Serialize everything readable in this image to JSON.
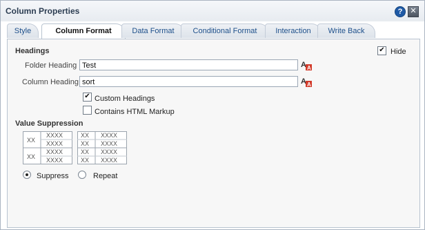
{
  "title": "Column Properties",
  "titlebar": {
    "help_glyph": "?",
    "close_glyph": "✕"
  },
  "tabs": [
    {
      "label": "Style",
      "active": false
    },
    {
      "label": "Column Format",
      "active": true
    },
    {
      "label": "Data Format",
      "active": false
    },
    {
      "label": "Conditional Format",
      "active": false
    },
    {
      "label": "Interaction",
      "active": false
    },
    {
      "label": "Write Back",
      "active": false
    }
  ],
  "headings": {
    "section_title": "Headings",
    "hide_label": "Hide",
    "hide_checked": true,
    "folder_heading_label": "Folder Heading",
    "folder_heading_value": "Test",
    "column_heading_label": "Column Heading",
    "column_heading_value": "sort",
    "custom_headings_label": "Custom Headings",
    "custom_headings_checked": true,
    "contains_html_label": "Contains HTML Markup",
    "contains_html_checked": false
  },
  "value_suppression": {
    "section_title": "Value Suppression",
    "cell_xx": "XX",
    "cell_xxxx": "XXXX",
    "suppress_label": "Suppress",
    "repeat_label": "Repeat",
    "selected": "Suppress"
  },
  "colors": {
    "tab_text": "#1d4f8a",
    "help_blue": "#1f5aa6",
    "fmt_icon_red": "#d23b2b"
  },
  "icons": [
    "help-icon",
    "close-icon",
    "edit-format-icon"
  ]
}
